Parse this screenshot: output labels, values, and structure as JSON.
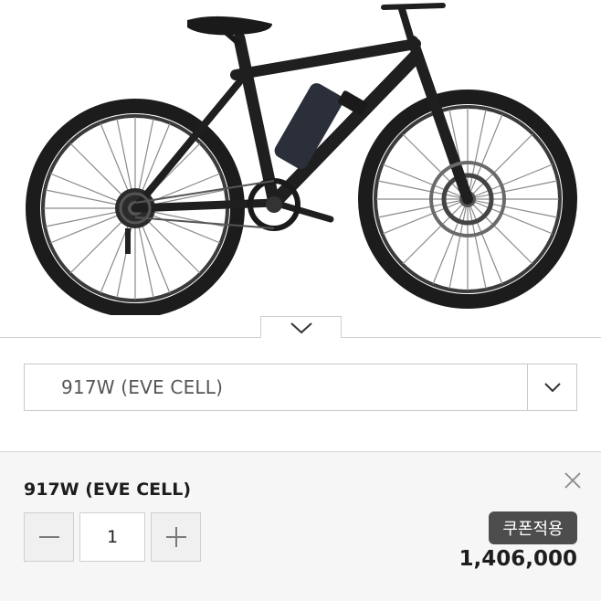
{
  "product_image": {
    "alt": "black electric mountain bicycle"
  },
  "collapse_toggle": {
    "icon": "chevron-down-icon"
  },
  "option_select": {
    "selected": "917W (EVE CELL)",
    "icon": "chevron-down-icon"
  },
  "selected_option": {
    "name": "917W (EVE CELL)",
    "quantity": "1",
    "coupon_label": "쿠폰적용",
    "price": "1,406,000",
    "close_icon": "close-icon",
    "minus_icon": "minus-icon",
    "plus_icon": "plus-icon"
  },
  "colors": {
    "coupon_bg": "#4d4d4d",
    "panel_bg": "#f6f6f6"
  }
}
